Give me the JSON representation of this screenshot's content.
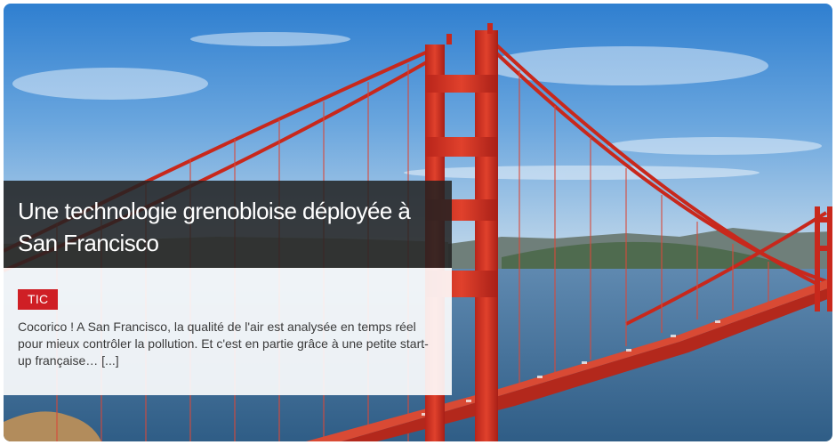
{
  "article": {
    "headline": "Une technologie grenobloise déployée à San Francisco",
    "tag": "TIC",
    "summary": "Cocorico ! A San Francisco, la qualité de l'air est analysée en temps réel pour mieux contrôler la pollution. Et c'est en partie grâce à une petite start-up française…",
    "more_label": "[...]",
    "image_subject": "golden-gate-bridge"
  },
  "colors": {
    "tag_bg": "#cf1f25",
    "headline_bg": "#222222",
    "summary_bg": "#ffffff",
    "bridge_red": "#d4301f",
    "sky_blue": "#4a8fd4",
    "water_blue": "#3d6e9e"
  }
}
